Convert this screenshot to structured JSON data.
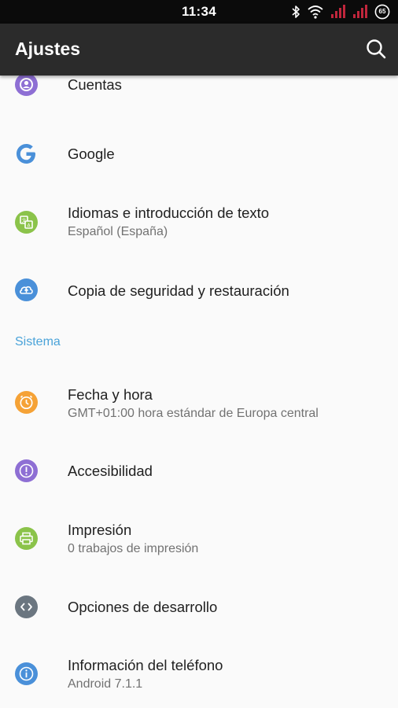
{
  "status_bar": {
    "time": "11:34",
    "battery_level": "65",
    "icons": [
      "bluetooth-icon",
      "wifi-icon",
      "signal-icon",
      "signal-icon",
      "battery-icon"
    ]
  },
  "app_bar": {
    "title": "Ajustes",
    "icon": "search-icon"
  },
  "colors": {
    "app_bar": "#2b2b2b",
    "accent": "#4aa3d9",
    "signal": "#c0263c"
  },
  "list": {
    "items": [
      {
        "title": "Cuentas",
        "icon": "account-icon",
        "icon_color": "#8e6fd4"
      },
      {
        "title": "Google",
        "icon": "google-icon",
        "icon_color": "#4a90d9"
      },
      {
        "title": "Idiomas e introducción de texto",
        "summary": "Español (España)",
        "icon": "language-icon",
        "icon_color": "#8bc34a"
      },
      {
        "title": "Copia de seguridad y restauración",
        "icon": "cloud-upload-icon",
        "icon_color": "#4a90d9"
      },
      {
        "title": "Fecha y hora",
        "summary": "GMT+01:00 hora estándar de Europa central",
        "icon": "clock-icon",
        "icon_color": "#f5a236"
      },
      {
        "title": "Accesibilidad",
        "icon": "accessibility-icon",
        "icon_color": "#8e6fd4"
      },
      {
        "title": "Impresión",
        "summary": "0 trabajos de impresión",
        "icon": "print-icon",
        "icon_color": "#8bc34a"
      },
      {
        "title": "Opciones de desarrollo",
        "icon": "code-icon",
        "icon_color": "#6b7680"
      },
      {
        "title": "Información del teléfono",
        "summary": "Android 7.1.1",
        "icon": "info-icon",
        "icon_color": "#4a90d9"
      }
    ],
    "section_sistema": "Sistema"
  }
}
